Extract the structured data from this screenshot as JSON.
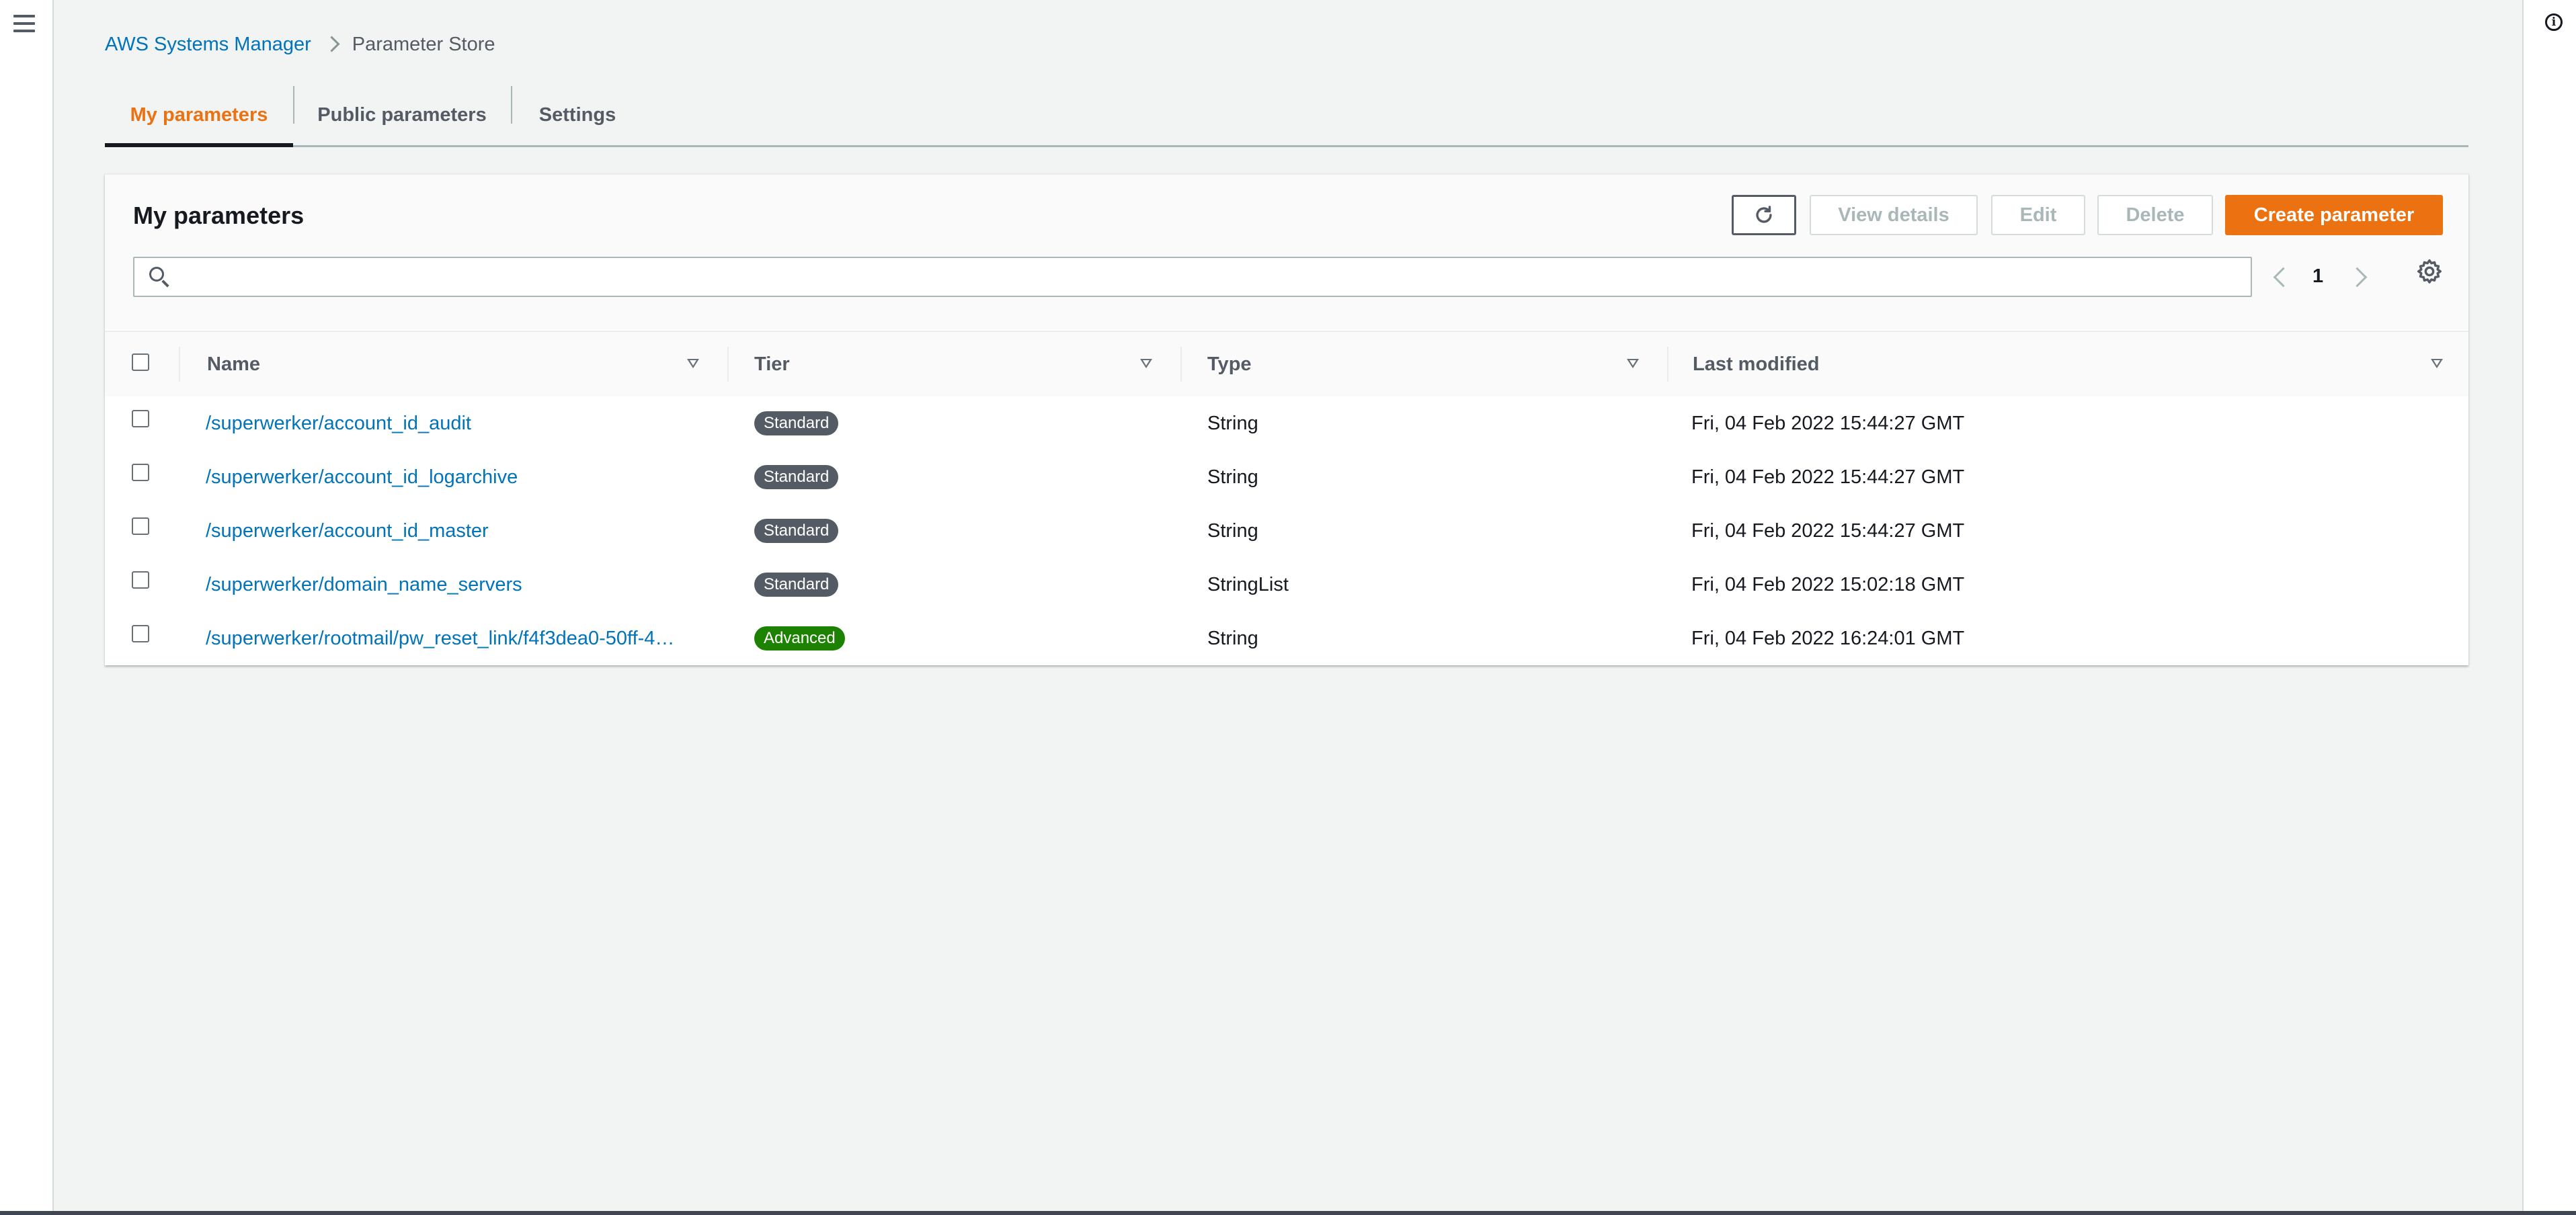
{
  "breadcrumb": {
    "root": "AWS Systems Manager",
    "current": "Parameter Store"
  },
  "tabs": [
    {
      "label": "My parameters",
      "active": true
    },
    {
      "label": "Public parameters",
      "active": false
    },
    {
      "label": "Settings",
      "active": false
    }
  ],
  "panel": {
    "title": "My parameters",
    "buttons": {
      "refresh_icon": "refresh-icon",
      "view_details": "View details",
      "edit": "Edit",
      "delete": "Delete",
      "create": "Create parameter"
    },
    "search": {
      "placeholder": "",
      "value": ""
    },
    "pagination": {
      "page": "1"
    }
  },
  "table": {
    "columns": [
      "Name",
      "Tier",
      "Type",
      "Last modified"
    ],
    "rows": [
      {
        "name": "/superwerker/account_id_audit",
        "tier": "Standard",
        "type": "String",
        "modified": "Fri, 04 Feb 2022 15:44:27 GMT"
      },
      {
        "name": "/superwerker/account_id_logarchive",
        "tier": "Standard",
        "type": "String",
        "modified": "Fri, 04 Feb 2022 15:44:27 GMT"
      },
      {
        "name": "/superwerker/account_id_master",
        "tier": "Standard",
        "type": "String",
        "modified": "Fri, 04 Feb 2022 15:44:27 GMT"
      },
      {
        "name": "/superwerker/domain_name_servers",
        "tier": "Standard",
        "type": "StringList",
        "modified": "Fri, 04 Feb 2022 15:02:18 GMT"
      },
      {
        "name": "/superwerker/rootmail/pw_reset_link/f4f3dea0-50ff-4…",
        "tier": "Advanced",
        "type": "String",
        "modified": "Fri, 04 Feb 2022 16:24:01 GMT"
      }
    ]
  },
  "colors": {
    "accent": "#ec7211",
    "link": "#0073bb",
    "standard_badge": "#545b64",
    "advanced_badge": "#1d8102"
  }
}
